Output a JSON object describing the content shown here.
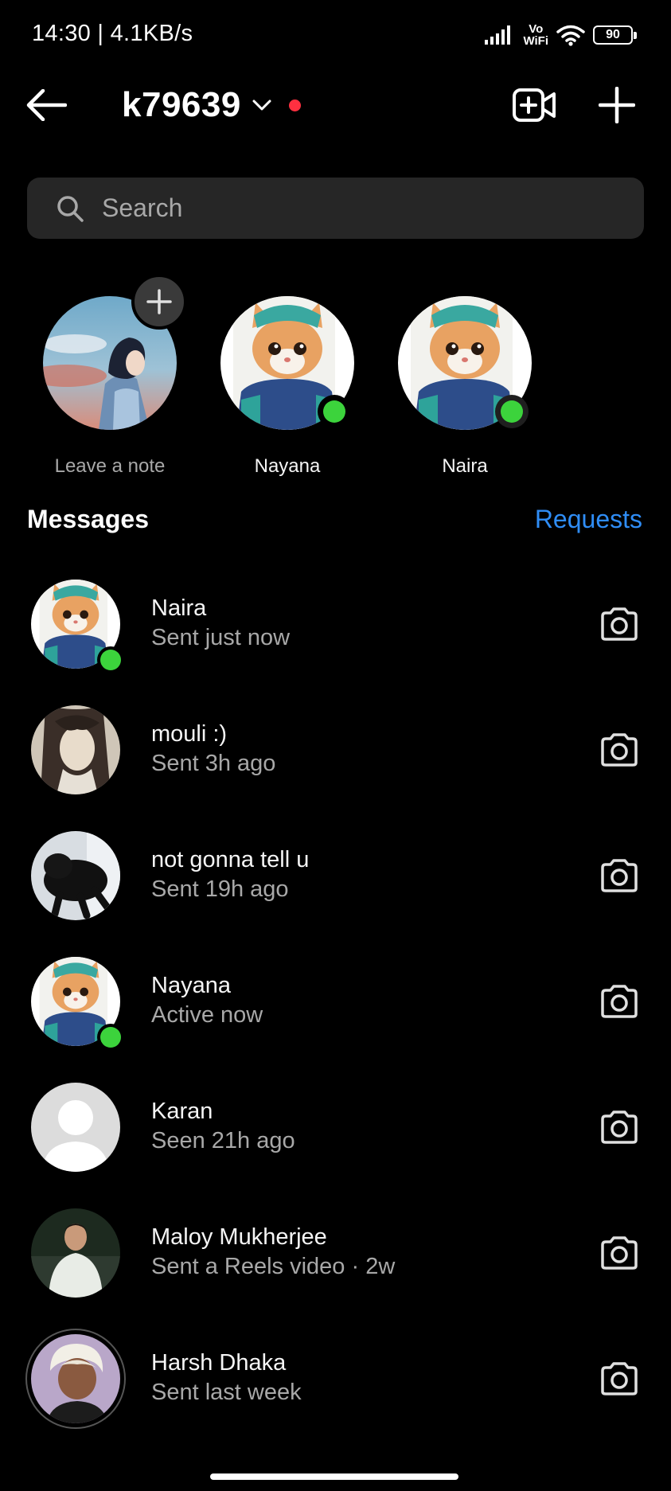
{
  "status_bar": {
    "time_speed": "14:30 | 4.1KB/s",
    "vowifi_top": "Vo",
    "vowifi_bottom": "WiFi",
    "battery": "90"
  },
  "header": {
    "username": "k79639"
  },
  "search": {
    "placeholder": "Search"
  },
  "notes": [
    {
      "label": "Leave a note"
    },
    {
      "label": "Nayana"
    },
    {
      "label": "Naira"
    }
  ],
  "messages_section": {
    "title": "Messages",
    "requests_label": "Requests"
  },
  "conversations": [
    {
      "name": "Naira",
      "status": "Sent just now",
      "online": true
    },
    {
      "name": "mouli :)",
      "status": "Sent 3h ago",
      "online": false
    },
    {
      "name": "not gonna tell u",
      "status": "Sent 19h ago",
      "online": false
    },
    {
      "name": "Nayana",
      "status": "Active now",
      "online": true
    },
    {
      "name": "Karan",
      "status": "Seen 21h ago",
      "online": false
    },
    {
      "name": "Maloy Mukherjee",
      "status": "Sent a Reels video · 2w",
      "online": false
    },
    {
      "name": "Harsh Dhaka",
      "status": "Sent last week",
      "online": false
    }
  ],
  "colors": {
    "background": "#000000",
    "accent_link": "#2f8df6",
    "online": "#3cd33c",
    "notification_dot": "#ff3040",
    "search_bg": "#262626"
  }
}
